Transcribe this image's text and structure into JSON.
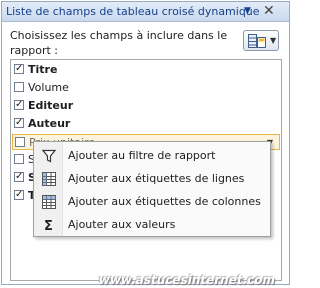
{
  "panel": {
    "title": "Liste de champs de tableau croisé dynamique",
    "dropdown_icon": "chevron-down-icon",
    "close_icon": "close-icon"
  },
  "instruction": "Choisissez les champs à inclure dans le rapport :",
  "layout_button": {
    "icon": "field-list-layout-icon"
  },
  "fields": [
    {
      "label": "Titre",
      "checked": true,
      "bold": true
    },
    {
      "label": "Volume",
      "checked": false,
      "bold": false
    },
    {
      "label": "Editeur",
      "checked": true,
      "bold": true
    },
    {
      "label": "Auteur",
      "checked": true,
      "bold": true
    },
    {
      "label": "Prix unitaire",
      "checked": false,
      "bold": false,
      "hover": true
    },
    {
      "label": "St",
      "checked": false,
      "bold": false
    },
    {
      "label": "S",
      "checked": true,
      "bold": true
    },
    {
      "label": "T",
      "checked": true,
      "bold": true
    }
  ],
  "context_menu": [
    {
      "label": "Ajouter au filtre de rapport",
      "icon": "filter-icon"
    },
    {
      "label": "Ajouter aux étiquettes de lignes",
      "icon": "row-labels-icon"
    },
    {
      "label": "Ajouter aux étiquettes de colonnes",
      "icon": "column-labels-icon"
    },
    {
      "label": "Ajouter aux valeurs",
      "icon": "sigma-icon"
    }
  ],
  "watermark": "www.astucesinternet.com",
  "colors": {
    "title_text": "#15428b",
    "hover_bg": "#fdf4db",
    "hover_border": "#e6b84b"
  }
}
